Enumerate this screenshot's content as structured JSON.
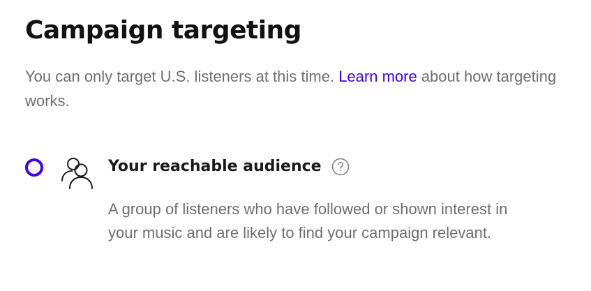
{
  "page": {
    "title": "Campaign targeting",
    "intro_before_link": "You can only target U.S. listeners at this time. ",
    "intro_link": "Learn more",
    "intro_after_link": " about how targeting works."
  },
  "targeting_option": {
    "title": "Your reachable audience",
    "description": "A group of listeners who have followed or shown interest in your music and are likely to find your campaign relevant.",
    "selected": true,
    "icon": "audience-group-icon",
    "help_icon": "help-circle-icon"
  },
  "colors": {
    "accent": "#4100f5",
    "heading": "#121212",
    "body_text": "#6e6e6e"
  }
}
